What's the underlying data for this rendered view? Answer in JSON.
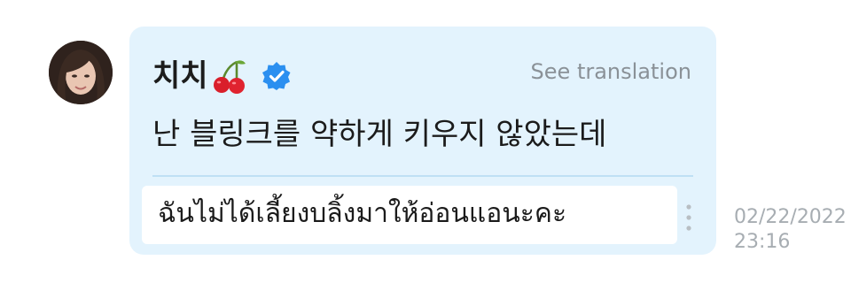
{
  "message": {
    "sender_name": "치치",
    "sender_emoji_icon": "cherry-icon",
    "verified_icon": "verified-badge-icon",
    "see_translation_label": "See translation",
    "text": "난 블링크를 약하게 키우지 않았는데",
    "translation_text": "ฉันไม่ได้เลี้ยงบลิ้งมาให้อ่อนแอนะคะ",
    "more_options_icon": "vertical-ellipsis-icon",
    "timestamp_date": "02/22/2022",
    "timestamp_time": "23:16"
  },
  "colors": {
    "bubble_background": "#e3f3fd",
    "verified_badge": "#2b8ff0",
    "secondary_text": "#8a9197",
    "timestamp_text": "#a7adb2"
  }
}
